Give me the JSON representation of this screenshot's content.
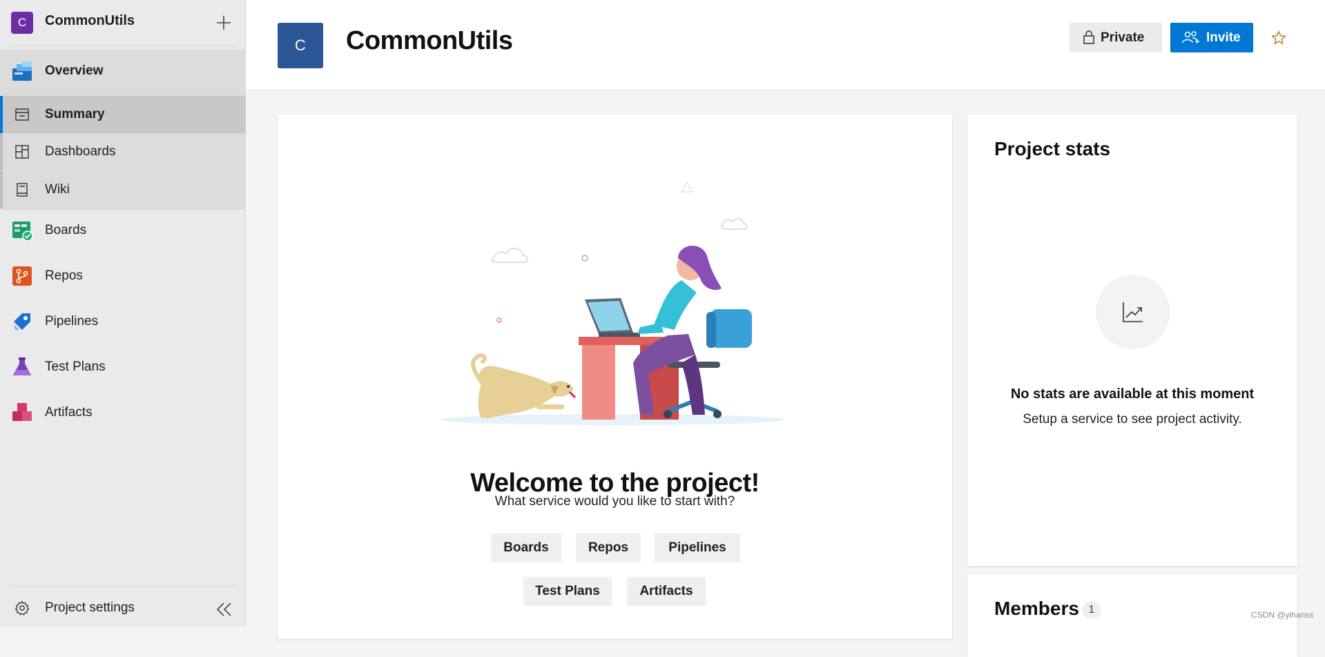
{
  "project": {
    "initial": "C",
    "name": "CommonUtils"
  },
  "sidebar": {
    "items": [
      {
        "key": "overview",
        "label": "Overview",
        "icon": "overview-icon"
      },
      {
        "key": "summary",
        "label": "Summary",
        "icon": "summary-icon",
        "selected": true
      },
      {
        "key": "dashboards",
        "label": "Dashboards",
        "icon": "dashboards-icon"
      },
      {
        "key": "wiki",
        "label": "Wiki",
        "icon": "wiki-icon"
      },
      {
        "key": "boards",
        "label": "Boards",
        "icon": "boards-icon"
      },
      {
        "key": "repos",
        "label": "Repos",
        "icon": "repos-icon"
      },
      {
        "key": "pipelines",
        "label": "Pipelines",
        "icon": "pipelines-icon"
      },
      {
        "key": "testplans",
        "label": "Test Plans",
        "icon": "test-plans-icon"
      },
      {
        "key": "artifacts",
        "label": "Artifacts",
        "icon": "artifacts-icon"
      }
    ],
    "settings_label": "Project settings"
  },
  "header": {
    "private_label": "Private",
    "invite_label": "Invite"
  },
  "welcome": {
    "title": "Welcome to the project!",
    "subtitle": "What service would you like to start with?",
    "services": [
      "Boards",
      "Repos",
      "Pipelines",
      "Test Plans",
      "Artifacts"
    ]
  },
  "stats": {
    "title": "Project stats",
    "empty_title": "No stats are available at this moment",
    "empty_subtitle": "Setup a service to see project activity."
  },
  "members": {
    "title": "Members",
    "count": "1"
  },
  "watermark": "CSDN @yihanss",
  "colors": {
    "accent": "#0078d4",
    "project_avatar_small": "#6b2fa3",
    "project_avatar_big": "#2b5797",
    "star": "#c47d2c"
  }
}
